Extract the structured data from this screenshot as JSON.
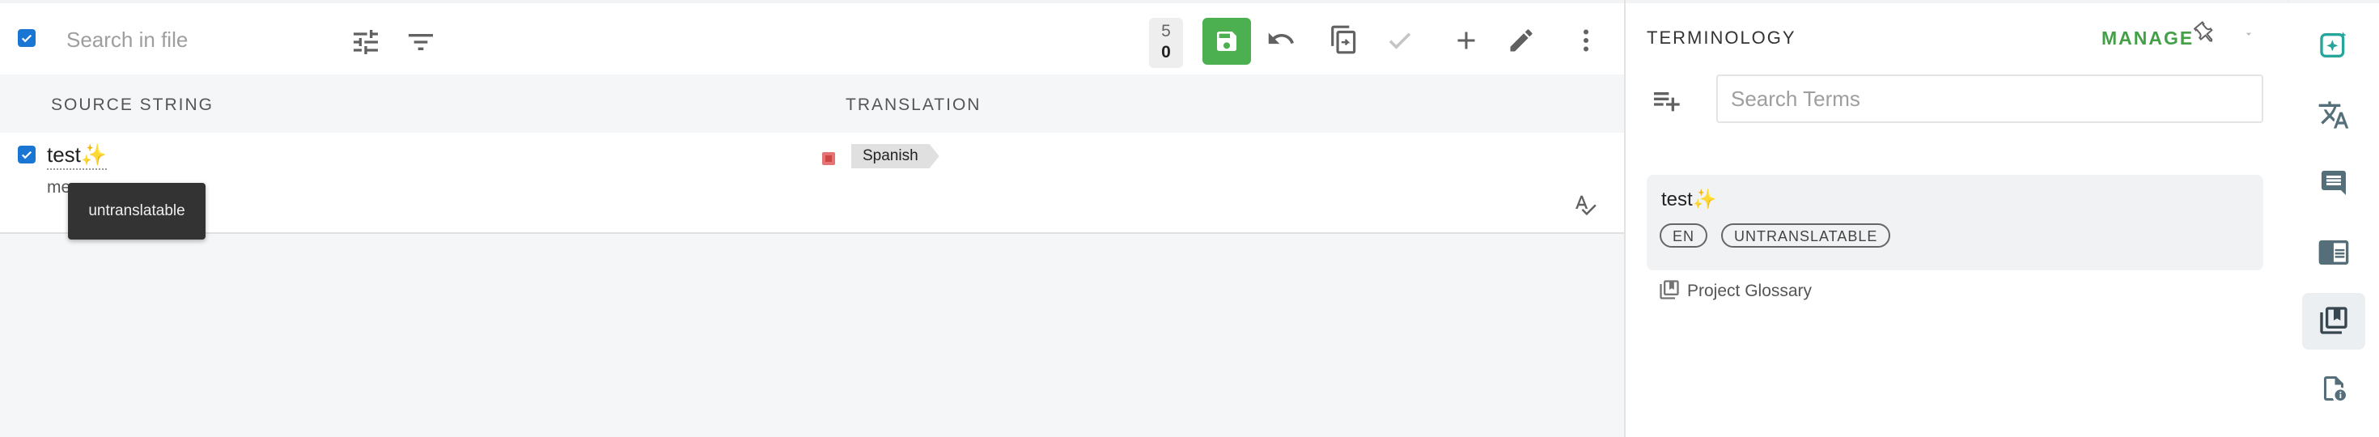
{
  "toolbar": {
    "search_placeholder": "Search in file",
    "counter_top": "5",
    "counter_bottom": "0"
  },
  "columns": {
    "source": "SOURCE STRING",
    "translation": "TRANSLATION"
  },
  "row": {
    "source_text": "test✨",
    "source_desc": "message",
    "language": "Spanish",
    "tooltip": "untranslatable"
  },
  "terminology": {
    "title": "TERMINOLOGY",
    "manage": "MANAGE",
    "search_placeholder": "Search Terms",
    "term": {
      "text": "test✨",
      "chips": [
        "EN",
        "UNTRANSLATABLE"
      ]
    },
    "glossary": "Project Glossary"
  },
  "rail": {
    "items": [
      "ai-assistant-icon",
      "translate-icon",
      "comments-icon",
      "preview-icon",
      "glossary-icon",
      "file-info-icon"
    ],
    "active": "glossary-icon"
  },
  "colors": {
    "accent_green": "#4caf50",
    "manage_green": "#43a047",
    "checkbox_blue": "#1976d2",
    "ai_teal": "#26a69a"
  }
}
